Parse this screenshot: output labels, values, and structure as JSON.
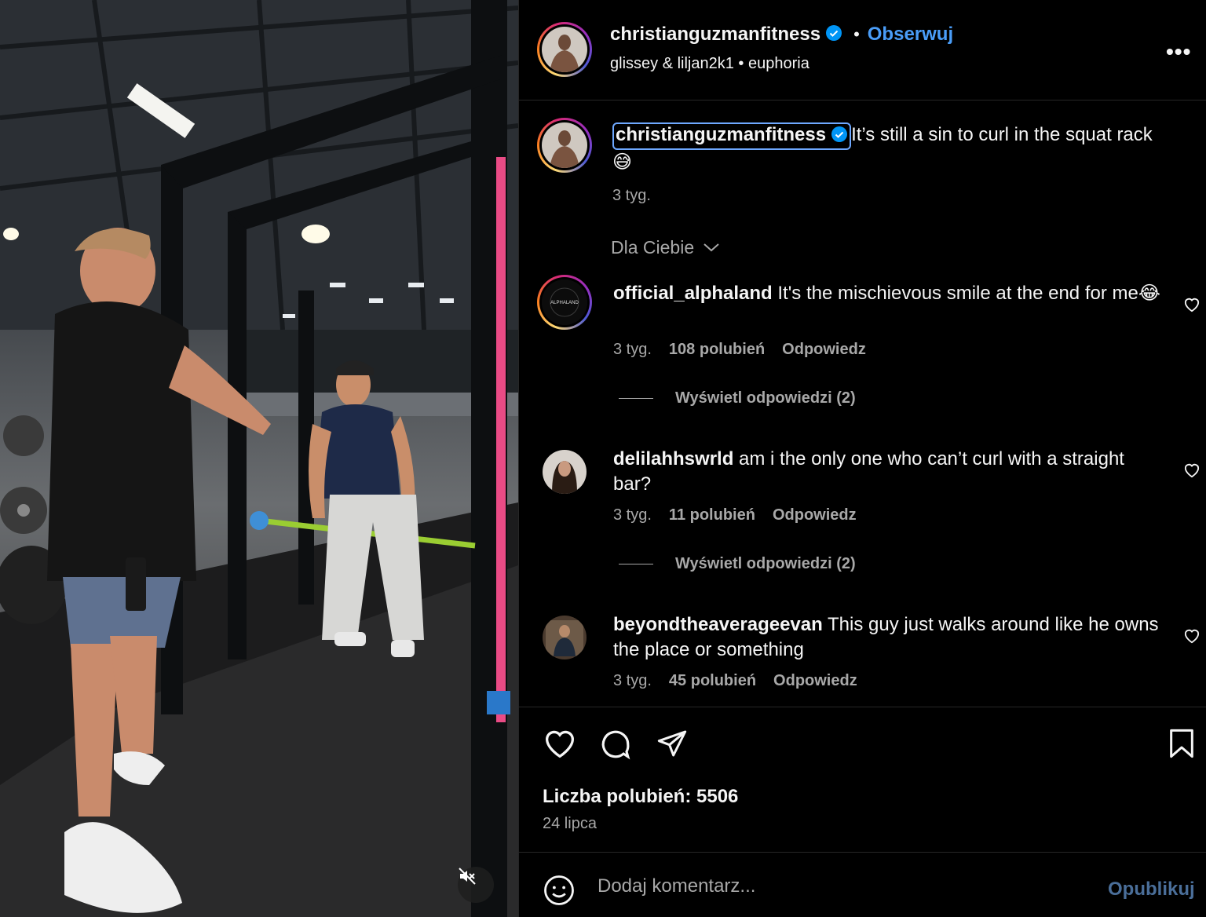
{
  "post": {
    "author": "christianguzmanfitness",
    "follow_label": "Obserwuj",
    "audio_artist": "glissey & liljan2k1",
    "audio_title": "euphoria",
    "more_icon": "more-horizontal-icon",
    "caption": {
      "author": "christianguzmanfitness",
      "text": "It’s still a sin to curl in the squat rack 😅",
      "time": "3 tyg."
    },
    "comments_filter": "Dla Ciebie",
    "comments": [
      {
        "user": "official_alphaland",
        "text": "It's the mischievous smile at the end for me😂",
        "time": "3 tyg.",
        "likes": "108 polubień",
        "reply": "Odpowiedz",
        "view_replies": "Wyświetl odpowiedzi (2)"
      },
      {
        "user": "delilahhswrld",
        "text": "am i the only one who can’t curl with a straight bar?",
        "time": "3 tyg.",
        "likes": "11 polubień",
        "reply": "Odpowiedz",
        "view_replies": "Wyświetl odpowiedzi (2)"
      },
      {
        "user": "beyondtheaverageevan",
        "text": "This guy just walks around like he owns the place or something",
        "time": "3 tyg.",
        "likes": "45 polubień",
        "reply": "Odpowiedz"
      }
    ],
    "likes_total": "Liczba polubień: 5506",
    "date": "24 lipca",
    "comment_placeholder": "Dodaj komentarz...",
    "post_label": "Opublikuj",
    "alphaland_logo_text": "ALPHALAND"
  },
  "colors": {
    "accent": "#4a9df8",
    "verified": "#0095f6",
    "background": "#000000",
    "muted_text": "#a8a8a8"
  }
}
